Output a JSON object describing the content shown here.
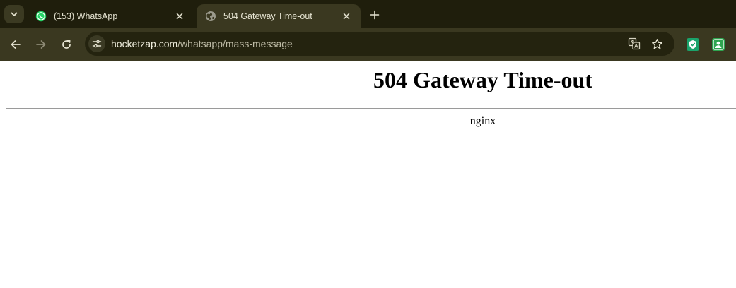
{
  "tabs": [
    {
      "title": "(153) WhatsApp",
      "favicon": "whatsapp-icon",
      "active": false
    },
    {
      "title": "504 Gateway Time-out",
      "favicon": "globe-icon",
      "active": true
    }
  ],
  "address_bar": {
    "host": "hocketzap.com",
    "path": "/whatsapp/mass-message"
  },
  "page": {
    "heading": "504 Gateway Time-out",
    "server": "nginx"
  },
  "colors": {
    "tabstrip": "#1f1e0c",
    "toolbar": "#3a3820",
    "omnibox": "#24230f",
    "whatsapp_green": "#25d366",
    "extension_green": "#1aa36b"
  }
}
